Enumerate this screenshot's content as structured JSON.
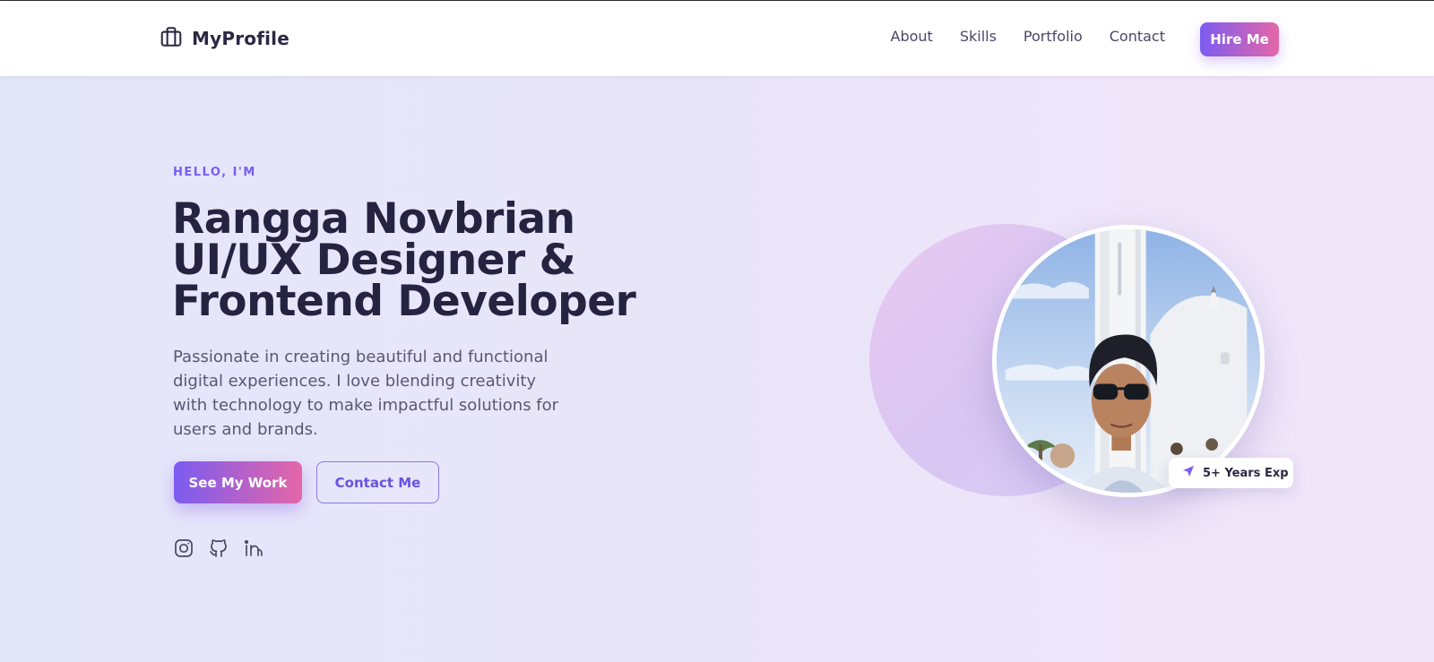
{
  "header": {
    "brand": "MyProfile",
    "brand_icon": "briefcase-icon",
    "nav": [
      "About",
      "Skills",
      "Portfolio",
      "Contact"
    ],
    "cta": "Hire Me"
  },
  "hero": {
    "eyebrow": "HELLO, I'M",
    "title_lines": [
      "Rangga Novbrian",
      "UI/UX Designer &",
      "Frontend Developer"
    ],
    "description": "Passionate in creating beautiful and functional digital experiences. I love blending creativity with technology to make impactful solutions for users and brands.",
    "primary_button": "See My Work",
    "secondary_button": "Contact Me",
    "socials": [
      "instagram-icon",
      "github-icon",
      "linkedin-icon"
    ]
  },
  "profile": {
    "badge": "5+ Years Exp",
    "badge_icon": "send-icon"
  },
  "colors": {
    "accent_purple": "#7b5cf1",
    "accent_pink": "#e466a8",
    "heading": "#252340",
    "body_text": "#5a5773",
    "background_left": "#e4e6fa",
    "background_right": "#f1e5f9"
  }
}
